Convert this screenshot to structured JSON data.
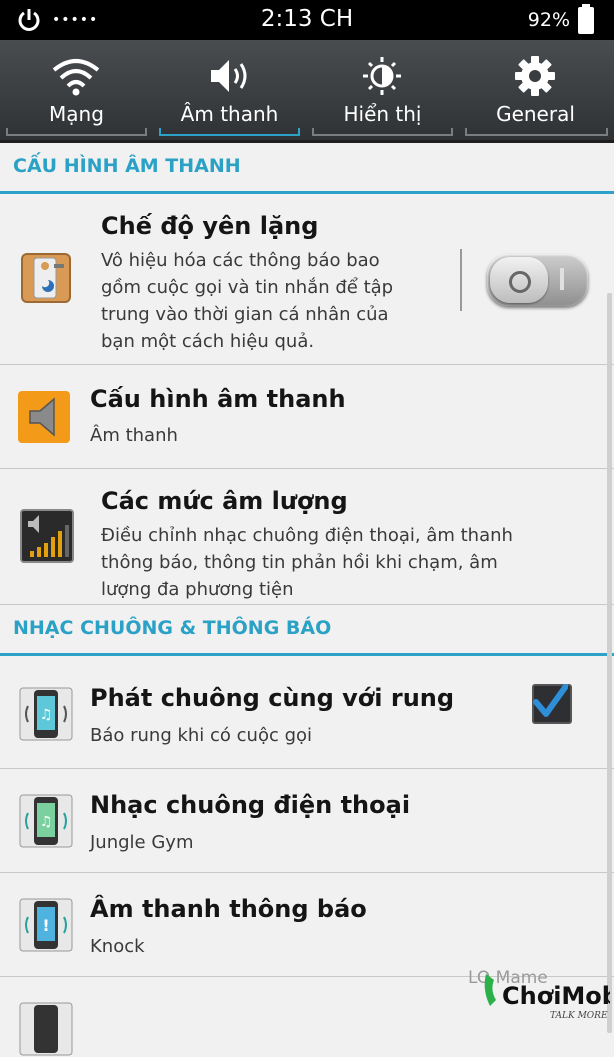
{
  "status_bar": {
    "signal_dots": "•••••",
    "time": "2:13 CH",
    "battery": "92%",
    "icons": [
      "power-icon",
      "battery-icon"
    ]
  },
  "tabs": [
    {
      "label": "Mạng",
      "icon": "wifi-icon",
      "active": false
    },
    {
      "label": "Âm thanh",
      "icon": "speaker-icon",
      "active": true
    },
    {
      "label": "Hiển thị",
      "icon": "brightness-icon",
      "active": false
    },
    {
      "label": "General",
      "icon": "gear-icon",
      "active": false
    }
  ],
  "sections": [
    {
      "title": "CẤU HÌNH ÂM THANH"
    },
    {
      "title": "NHẠC CHUÔNG & THÔNG BÁO"
    }
  ],
  "rows": [
    {
      "title": "Chế độ yên lặng",
      "subtitle_lines": [
        "Vô hiệu hóa các thông báo bao",
        "gồm cuộc gọi và tin nhắn để tập",
        "trung vào thời gian cá nhân của",
        "bạn một cách hiệu quả."
      ],
      "icon": "door-hanger-icon",
      "toggle_on": false
    },
    {
      "title": "Cấu hình âm thanh",
      "subtitle_lines": [
        "Âm thanh"
      ],
      "icon": "speaker-orange-icon"
    },
    {
      "title": "Các mức âm lượng",
      "subtitle_lines": [
        "Điều chỉnh nhạc chuông điện thoại, âm thanh",
        "thông báo, thông tin phản hồi khi chạm, âm",
        "lượng đa phương tiện"
      ],
      "icon": "volume-levels-icon"
    },
    {
      "title": "Phát chuông cùng với rung",
      "subtitle_lines": [
        "Báo rung khi có cuộc gọi"
      ],
      "icon": "phone-vibrate-music-icon",
      "checked": true
    },
    {
      "title": "Nhạc chuông điện thoại",
      "subtitle_lines": [
        "Jungle Gym"
      ],
      "icon": "phone-ringtone-icon"
    },
    {
      "title": "Âm thanh thông báo",
      "subtitle_lines": [
        "Knock"
      ],
      "icon": "phone-notification-icon"
    }
  ],
  "watermark": {
    "text": "LO Mame",
    "brand": "ChơiMobile",
    "tagline": "TALK MORE"
  },
  "colors": {
    "accent": "#2da1c7",
    "tabbar": "#3a3d40",
    "background": "#f1f1f1"
  }
}
